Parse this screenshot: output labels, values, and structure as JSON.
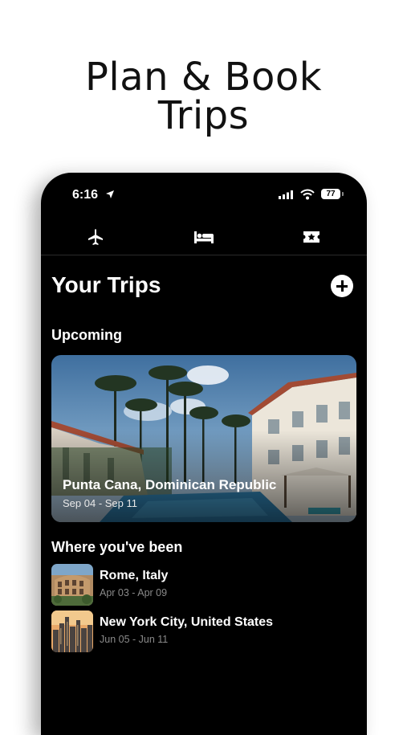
{
  "headline": {
    "line1": "Plan & Book",
    "line2": "Trips"
  },
  "status_bar": {
    "time": "6:16",
    "battery": "77"
  },
  "tabs": [
    {
      "icon": "airplane-icon"
    },
    {
      "icon": "bed-icon"
    },
    {
      "icon": "ticket-icon"
    }
  ],
  "page": {
    "title": "Your Trips",
    "add_icon": "plus-circle-icon"
  },
  "upcoming": {
    "label": "Upcoming",
    "trip": {
      "title": "Punta Cana, Dominican Republic",
      "dates": "Sep 04 - Sep 11"
    }
  },
  "past": {
    "label": "Where you've been",
    "trips": [
      {
        "title": "Rome, Italy",
        "dates": "Apr 03 - Apr 09"
      },
      {
        "title": "New York City, United States",
        "dates": "Jun 05 - Jun 11"
      }
    ]
  }
}
